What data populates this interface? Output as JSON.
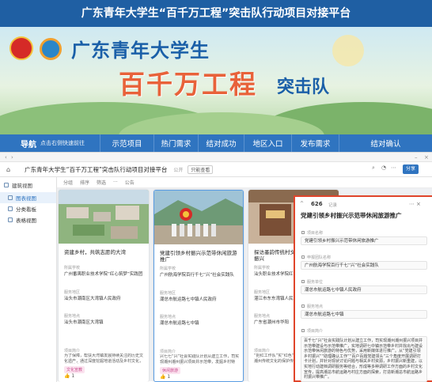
{
  "page_title": "广东青年大学生“百千万工程”突击队行动项目对接平台",
  "banner": {
    "line1": "广东青年大学生",
    "line2": "百千万工程",
    "line3": "突击队"
  },
  "nav": {
    "brand": "导航",
    "hint": "点击右侧快速前往",
    "tabs": [
      "示范项目",
      "热门需求",
      "结对成功",
      "地区入口",
      "发布需求",
      "结对确认"
    ]
  },
  "app": {
    "doc_title": "广东青年大学生“百千万工程”突击队行动项目对接平台",
    "toolbar_meta": "公开",
    "toolbar_pill": "只能查看",
    "share_label": "分享",
    "sidebar": {
      "header": "建筑视图",
      "items": [
        "图表视图",
        "分类看板",
        "表格视图"
      ]
    },
    "viewbar": [
      "分组",
      "排序",
      "筛选",
      "···",
      "公告"
    ]
  },
  "cards": [
    {
      "title": "资建乡村，共筑志愿的大湾",
      "dept_label": "所属学校",
      "dept": "广州番禺职业技术学院“红心筑梦”实践团",
      "region_label": "服务地区",
      "region": "汕头市潮南区大湾镇人民政府",
      "contact_label": "服务地点",
      "contact": "汕头市潮南区大湾镇",
      "desc_label": "项目简介",
      "desc": "为了保障，帮扶大湾镇发展持续关注的历史文化遗产，通过深度挖掘地道活动及乡村文化，为当地乡村",
      "tag": "文化宣教",
      "likes": "1"
    },
    {
      "title": "党建引领乡村振兴示范带休闲旅游推广",
      "dept_label": "所属学校",
      "dept": "广州航海学院百行千七“兴”社会实践队",
      "region_label": "服务地区",
      "region": "潮总市航运路七中镇人民政府",
      "contact_label": "服务地点",
      "contact": "潮总市航运路七中镇",
      "desc_label": "项目简介",
      "desc": "兴七七“兴”社会实践队计划从建立工作，司实现潮州潮州振兴项目并示范带，发掘乡村特色，打造示范",
      "tag": "休闲旅游",
      "likes": "1"
    },
    {
      "title": "探访墨韵传统村文化，助力新时代振兴",
      "dept_label": "所属学校",
      "dept": "汕头职业技术学院红色实践队",
      "region_label": "服务地区",
      "region": "湛江市东东湾镇人民政府",
      "contact_label": "服务地点",
      "contact": "广东省潮州市华阳",
      "desc_label": "项目简介",
      "desc": "“把红工作队”实“红色”乡村墨韵传统村文化的潮州传统文化的保护传承，了解墨韵传统文化",
      "tag": "",
      "likes": ""
    }
  ],
  "detail": {
    "count": "626",
    "count_suffix": "记录",
    "title": "党建引领乡村振兴示范带休闲旅游推广",
    "fields": [
      {
        "label": "项目名称",
        "value": "党建引领乡村振兴示范带休闲旅游推广"
      },
      {
        "label": "申报团队名称",
        "value": "广州航海学院百行千七“兴”社会实践队"
      },
      {
        "label": "服务单位",
        "value": "潮总市航运路七中镇人民政府"
      },
      {
        "label": "服务地点",
        "value": "潮总市航运路七中镇"
      }
    ],
    "desc_label": "项目简介",
    "desc": "百千七“兴”社会实践队计划从建立工作，司实现潮州潮州振兴项目并示范带建设与示范带推广，实地调研七中镇示范带乡村并找出与建设示范带休闲旅游的特色与优势，采用新媒体进行推广。从“党建引领乡村振兴”“助理确认工作”“百户百题党建领头”三个角度开展调研打卡计划，并针对现状讨论问题与相关乡村资源，乡村振兴新重建，以实地行动建档调研服务等结合，形成等多种调研工作方面的乡村文化宣传，提高潮总市航运路与村庄方面的探索，打造新潮总市航运路乡村振兴带推广。"
  }
}
